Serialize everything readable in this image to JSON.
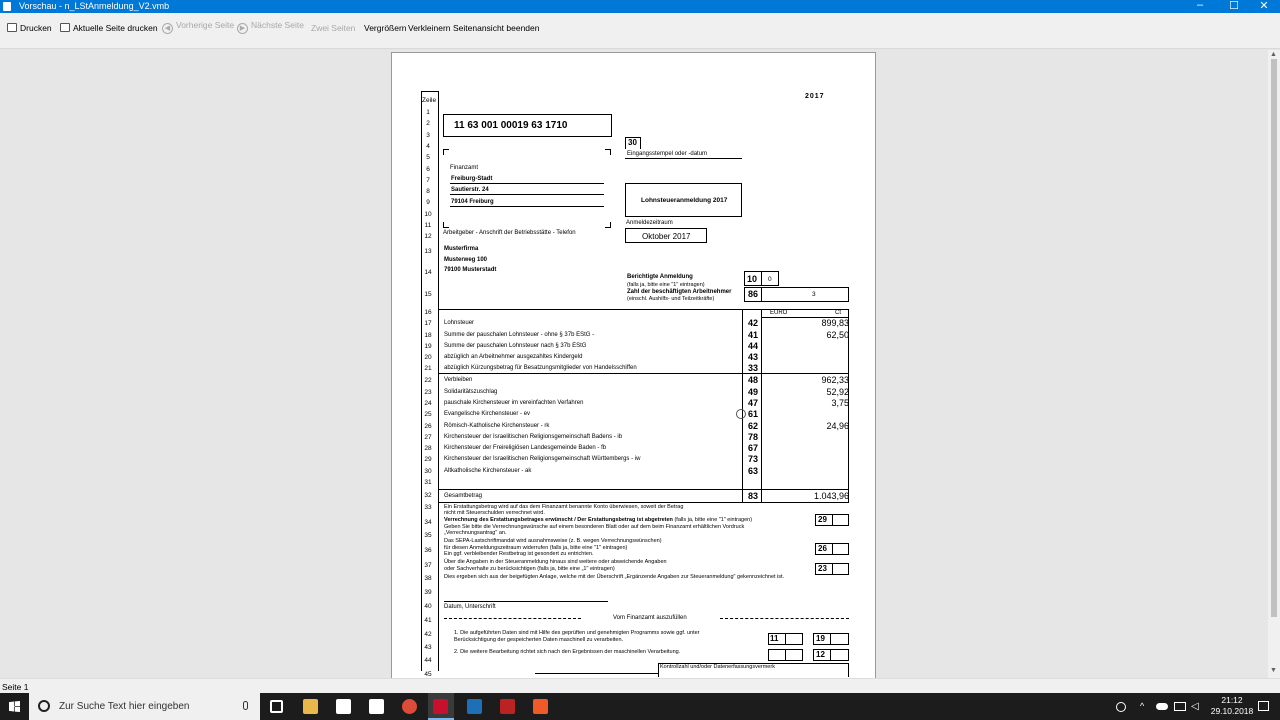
{
  "window": {
    "title": "Vorschau - n_LStAnmeldung_V2.vmb",
    "controls": [
      "–",
      "☐",
      "✕"
    ]
  },
  "toolbar": {
    "print": "Drucken",
    "print_page": "Aktuelle Seite drucken",
    "prev": "Vorherige Seite",
    "next": "Nächste Seite",
    "two": "Zwei Seiten",
    "zoom_in": "Vergrößern",
    "zoom_out": "Verkleinern",
    "close": "Seitenansicht beenden"
  },
  "status": "Seite 1",
  "taskbar": {
    "search_placeholder": "Zur Suche Text hier eingeben",
    "time": "21:12",
    "date": "29.10.2018"
  },
  "form": {
    "year": "2017",
    "zeile": "Zeile",
    "line_numbers": [
      "1",
      "2",
      "3",
      "4",
      "5",
      "6",
      "7",
      "8",
      "9",
      "10",
      "11",
      "12",
      "13",
      "14",
      "15",
      "16",
      "17",
      "18",
      "19",
      "20",
      "21",
      "22",
      "23",
      "24",
      "25",
      "26",
      "27",
      "28",
      "29",
      "30",
      "31",
      "32",
      "33",
      "34",
      "35",
      "36",
      "37",
      "38",
      "39",
      "40",
      "41",
      "42",
      "43",
      "44",
      "45"
    ],
    "steuernummer": "11  63  001  00019  63  1710",
    "stamp_code": "30",
    "stamp_label": "Eingangsstempel oder -datum",
    "finanzamt": "Finanzamt",
    "fa_name": "Freiburg-Stadt",
    "fa_street": "Sautierstr. 24",
    "fa_city": "79104 Freiburg",
    "doc_title": "Lohnsteueranmeldung 2017",
    "period_label": "Anmeldezeitraum",
    "period": "Oktober 2017",
    "employer_label": "Arbeitgeber - Anschrift der Betriebsstätte - Telefon",
    "employer": [
      "Musterfirma",
      "Musterweg 100",
      "79100 Musterstadt"
    ],
    "corrected_label": "Berichtigte Anmeldung",
    "corrected_sub": "(falls ja, bitte eine \"1\" eintragen)",
    "corrected_code": "10",
    "corrected_value": "0",
    "employees_label": "Zahl der beschäftigten Arbeitnehmer",
    "employees_sub": "(einschl. Aushilfs- und Teilzeitkräfte)",
    "employees_code": "86",
    "employees_value": "3",
    "col_euro": "EURO",
    "col_ct": "Ct",
    "rows": [
      {
        "label": "Lohnsteuer",
        "code": "42",
        "value": "899,83"
      },
      {
        "label": "Summe der pauschalen Lohnsteuer - ohne § 37b EStG -",
        "code": "41",
        "value": "62,50"
      },
      {
        "label": "Summe der pauschalen Lohnsteuer nach § 37b EStG",
        "code": "44",
        "value": ""
      },
      {
        "label": "abzüglich an Arbeitnehmer ausgezahltes Kindergeld",
        "code": "43",
        "value": ""
      },
      {
        "label": "abzüglich Kürzungsbetrag für Besatzungsmitglieder von Handelsschiffen",
        "code": "33",
        "value": ""
      },
      {
        "label": "Verbleiben",
        "code": "48",
        "value": "962,33"
      },
      {
        "label": "Solidaritätszuschlag",
        "code": "49",
        "value": "52,92"
      },
      {
        "label": "pauschale Kirchensteuer im vereinfachten Verfahren",
        "code": "47",
        "value": "3,75"
      },
      {
        "label": "Evangelische Kirchensteuer - ev",
        "code": "61",
        "value": ""
      },
      {
        "label": "Römisch-Katholische Kirchensteuer - rk",
        "code": "62",
        "value": "24,96"
      },
      {
        "label": "Kirchensteuer der Israelitischen Religionsgemeinschaft Badens - ib",
        "code": "78",
        "value": ""
      },
      {
        "label": "Kirchensteuer der Freireligiösen Landesgemeinde Baden - fb",
        "code": "67",
        "value": ""
      },
      {
        "label": "Kirchensteuer der Israelitischen Religionsgemeinschaft Württembergs - iw",
        "code": "73",
        "value": ""
      },
      {
        "label": "Altkatholische Kirchensteuer - ak",
        "code": "63",
        "value": ""
      }
    ],
    "total_label": "Gesamtbetrag",
    "total_code": "83",
    "total_value": "1.043,96",
    "t33a": "Ein Erstattungsbetrag wird auf das dem Finanzamt benannte Konto überwiesen, soweit der Betrag",
    "t33b": "nicht mit Steuerschulden verrechnet wird.",
    "t34a": "Verrechnung des Erstattungsbetrages erwünscht / Der Erstattungsbetrag ist abgetreten",
    "t34b": "(falls ja, bitte eine \"1\" eintragen)",
    "t34c": "Geben Sie bitte die Verrechnungswünsche auf einem besonderen Blatt oder auf dem beim Finanzamt erhältlichen Vordruck",
    "t34d": "„Verrechnungsantrag\" an.",
    "t35a": "Das SEPA-Lastschriftmandat wird ausnahmsweise (z. B. wegen Verrechnungswünschen)",
    "t36a": "für diesen Anmeldungszeitraum widerrufen (falls ja, bitte eine \"1\" eintragen)",
    "t36b": "Ein ggf. verbleibender Restbetrag ist gesondert zu entrichten.",
    "t37a": "Über die Angaben in der Steueranmeldung hinaus sind weitere oder abweichende Angaben",
    "t37b": "oder Sachverhalte zu berücksichtigen (falls ja, bitte eine „1\" eintragen)",
    "t38a": "Dies ergeben sich aus der beigefügten Anlage, welche mit der Überschrift „Ergänzende Angaben zur Steueranmeldung\" gekennzeichnet ist.",
    "c29": "29",
    "c26": "26",
    "c23": "23",
    "sig_label": "Datum, Unterschrift",
    "fa_section": "Vom Finanzamt auszufüllen",
    "t42a": "1. Die aufgeführten Daten sind mit Hilfe des geprüften und genehmigten Programms sowie ggf. unter",
    "t42b": "Berücksichtigung der gespeicherten Daten maschinell zu verarbeiten.",
    "t44a": "2. Die weitere Bearbeitung richtet sich nach den Ergebnissen der maschinellen Verarbeitung.",
    "c11": "11",
    "c19": "19",
    "c12": "12",
    "kontroll": "Kontrollzahl und/oder Datenerfassungsvermerk"
  }
}
